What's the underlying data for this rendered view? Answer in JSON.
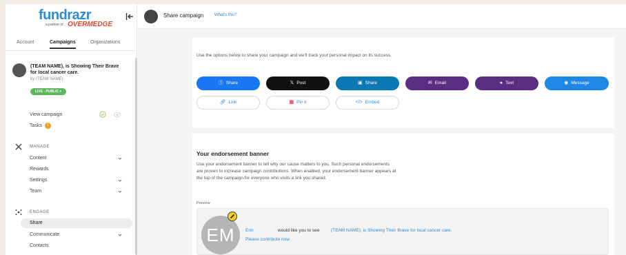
{
  "sidebar": {
    "logo": {
      "main": "fundrazr",
      "sub": "a partner of",
      "brand": "OVERMEDGE"
    },
    "tabs": [
      "Account",
      "Campaigns",
      "Organizations"
    ],
    "campaign": {
      "title": "(TEAM NAME), is Showing Their Brave for local cancer care.",
      "by": "by (TEAM NAME)",
      "status": "LIVE - PUBLIC ▾"
    },
    "view_campaign": "View campaign",
    "tasks": "Tasks",
    "tasks_count": "1",
    "manage_label": "MANAGE",
    "manage_items": [
      "Content",
      "Rewards",
      "Settings",
      "Team"
    ],
    "engage_label": "ENGAGE",
    "engage_items": [
      "Share",
      "Communicate",
      "Contacts"
    ]
  },
  "header": {
    "title": "Share campaign",
    "help": "What's this?"
  },
  "share": {
    "intro": "Use the options below to share your campaign and we'll track your personal impact on its success.",
    "buttons": [
      {
        "label": "Share",
        "icon": "facebook-icon",
        "color": "#1877f2"
      },
      {
        "label": "Post",
        "icon": "x-icon",
        "color": "#111111"
      },
      {
        "label": "Share",
        "icon": "linkedin-icon",
        "color": "#0a78b5"
      },
      {
        "label": "Email",
        "icon": "email-icon",
        "color": "#5b2d82"
      },
      {
        "label": "Text",
        "icon": "chat-icon",
        "color": "#5b2d82"
      },
      {
        "label": "Message",
        "icon": "messenger-icon",
        "color": "#1e88e5"
      }
    ],
    "secondary": [
      {
        "label": "Link",
        "icon": "link-icon"
      },
      {
        "label": "Pin it",
        "icon": "pinterest-icon"
      },
      {
        "label": "Embed",
        "icon": "code-icon"
      }
    ]
  },
  "banner": {
    "title": "Your endorsement banner",
    "text": "Use your endorsement banner to tell why our cause matters to you. Such personal endorsements are proven to increase campaign contributions. When enabled, your endorsement banner appears at the top of the campaign for everyone who visits a link you shared.",
    "preview_label": "Preview",
    "avatar_initials": "EM",
    "name": "Erin",
    "middle": "would like you to see",
    "link": "(TEAM NAME), is Showing Their Brave for local cancer care.",
    "contribute": "Please contribute now"
  }
}
